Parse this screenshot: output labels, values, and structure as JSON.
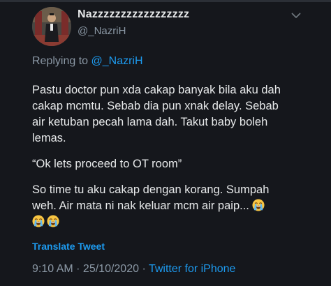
{
  "tweet": {
    "author": {
      "display_name": "Nazzzzzzzzzzzzzzzzz",
      "handle": "@_NazriH",
      "avatar_icon": "profile-photo"
    },
    "replying_to": {
      "prefix": "Replying to",
      "mention": "@_NazriH"
    },
    "paragraphs": [
      {
        "lines": [
          "Pastu doctor pun xda cakap banyak bila aku dah",
          "cakap mcmtu. Sebab dia pun xnak delay. Sebab",
          "air ketuban pecah lama dah. Takut baby boleh",
          "lemas."
        ]
      },
      {
        "lines": [
          "“Ok lets proceed to OT room”"
        ]
      },
      {
        "lines": [
          "So time tu aku cakap dengan korang. Sumpah",
          "weh. Air mata ni nak keluar mcm air paip..."
        ]
      }
    ],
    "emoji_icon": "loudly-crying-face",
    "emoji_count_line1": 1,
    "emoji_count_line2": 2,
    "translate_label": "Translate Tweet",
    "time": "9:10 AM",
    "separator1": " · ",
    "date": "25/10/2020",
    "separator2": " · ",
    "source": "Twitter for iPhone"
  },
  "colors": {
    "background": "#15171c",
    "text": "#e7e9ea",
    "secondary": "#8b98a5",
    "accent": "#1d9bf0"
  }
}
